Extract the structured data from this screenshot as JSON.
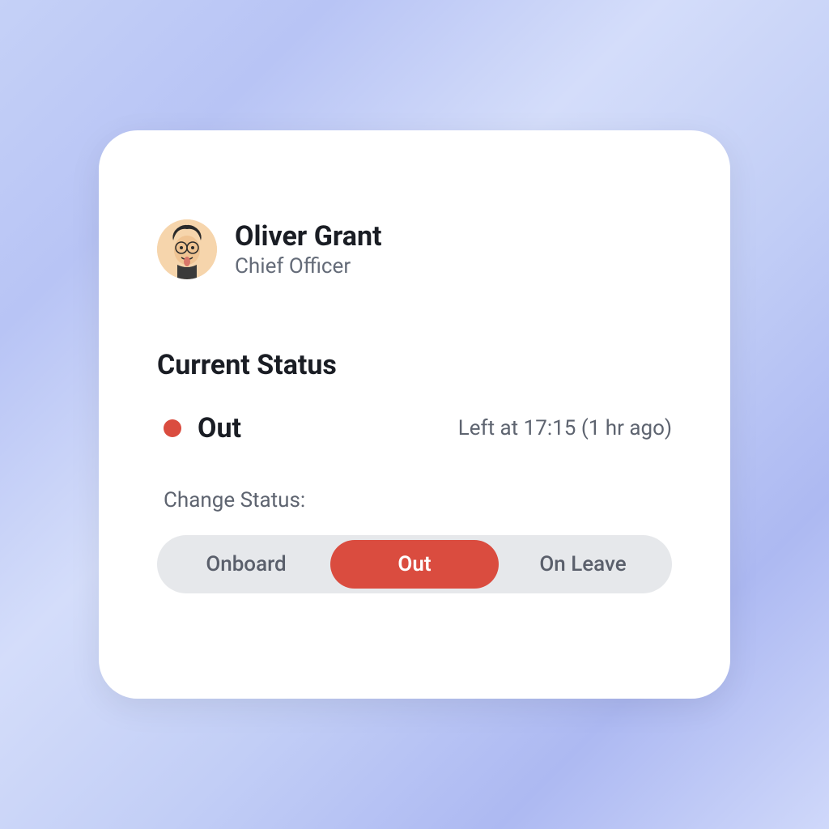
{
  "profile": {
    "name": "Oliver Grant",
    "role": "Chief Officer"
  },
  "status": {
    "section_title": "Current Status",
    "value": "Out",
    "dot_color": "#da4c3f",
    "meta": "Left at 17:15 (1 hr ago)",
    "change_label": "Change Status:",
    "options": [
      {
        "label": "Onboard",
        "active": false
      },
      {
        "label": "Out",
        "active": true
      },
      {
        "label": "On Leave",
        "active": false
      }
    ]
  }
}
